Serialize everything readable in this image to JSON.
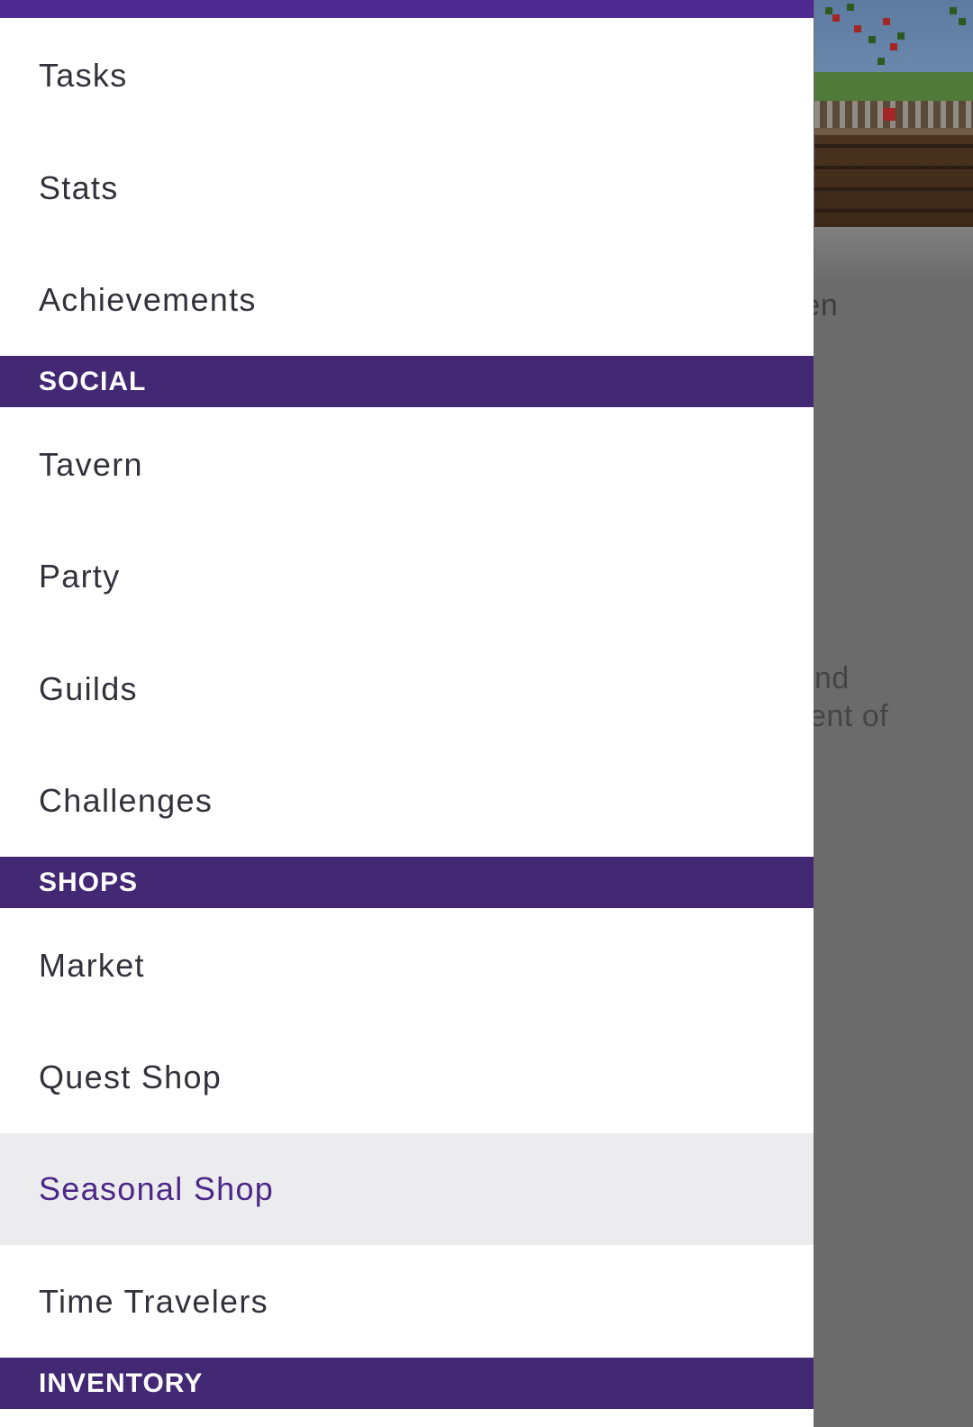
{
  "background": {
    "partial_texts": [
      "pen",
      "nd",
      "ent of"
    ]
  },
  "drawer": {
    "items_top": [
      {
        "label": "Tasks"
      },
      {
        "label": "Stats"
      },
      {
        "label": "Achievements"
      }
    ],
    "section_social": "SOCIAL",
    "items_social": [
      {
        "label": "Tavern"
      },
      {
        "label": "Party"
      },
      {
        "label": "Guilds"
      },
      {
        "label": "Challenges"
      }
    ],
    "section_shops": "SHOPS",
    "items_shops": [
      {
        "label": "Market"
      },
      {
        "label": "Quest Shop"
      },
      {
        "label": "Seasonal Shop",
        "active": true
      },
      {
        "label": "Time Travelers"
      }
    ],
    "section_inventory": "INVENTORY"
  },
  "colors": {
    "accent": "#4f2a93",
    "section_bg": "#432874",
    "active_text": "#4a2886",
    "scrim": "#6b6b6b"
  }
}
